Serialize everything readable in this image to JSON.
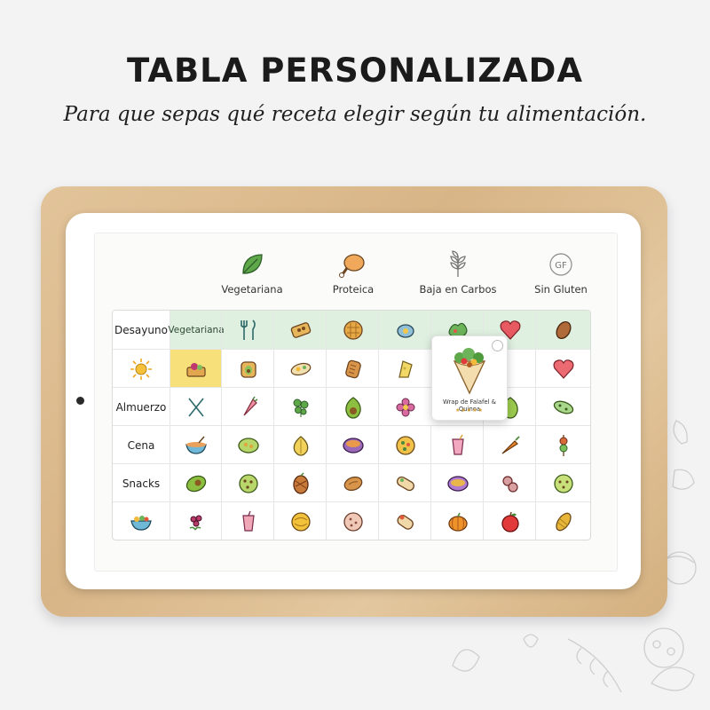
{
  "header": {
    "title": "TABLA PERSONALIZADA",
    "subtitle": "Para que sepas qué receta elegir según tu alimentación."
  },
  "legend": [
    {
      "label": "Vegetariana",
      "icon": "leaf-icon"
    },
    {
      "label": "Proteica",
      "icon": "chicken-leg-icon"
    },
    {
      "label": "Baja en Carbos",
      "icon": "wheat-icon"
    },
    {
      "label": "Sin Gluten",
      "icon": "gf-badge-icon"
    }
  ],
  "table": {
    "header_chip": "Vegetariana",
    "rows": [
      {
        "label": "Desayuno",
        "icons": [
          "vegetariana-chip",
          "cutlery-icon",
          "toast-icon",
          "waffle-icon",
          "egg-avocado-icon",
          "salad-icon",
          "heart-icon",
          "almond-icon"
        ]
      },
      {
        "label": "",
        "label_icon": "sun-icon",
        "icons": [
          "avocado-toast-icon",
          "avocado-toast-small-icon",
          "egg-toast-icon",
          "bread-icon",
          "cheese-icon",
          "salad-bowl-icon",
          "heart-icon"
        ]
      },
      {
        "label": "Almuerzo",
        "icons": [
          "cutlery-cross-icon",
          "carrot-wrap-icon",
          "herb-icon",
          "avocado-icon",
          "flower-plate-icon",
          "wrap-icon",
          "cucumber-icon"
        ]
      },
      {
        "label": "Cena",
        "icons": [
          "soup-bowl-icon",
          "curry-bowl-icon",
          "onion-icon",
          "soup-icon",
          "pizza-icon",
          "smoothie-icon",
          "carrot-icon",
          "skewer-icon"
        ]
      },
      {
        "label": "Snacks",
        "icons": [
          "avocado-half-icon",
          "cookie-icon",
          "pinecone-icon",
          "bread-loaf-icon",
          "burrito-icon",
          "stew-bowl-icon",
          "tomato-slices-icon",
          "cracker-icon"
        ]
      },
      {
        "label": "",
        "label_icon": "salad-bowl-icon",
        "icons": [
          "berries-icon",
          "drink-icon",
          "pasta-ball-icon",
          "cookie-icon",
          "wrap-roll-icon",
          "pumpkin-icon",
          "apple-icon",
          "corn-icon"
        ]
      }
    ]
  },
  "popup": {
    "title": "Wrap de Falafel & Quinoa",
    "stars": "★★★★★",
    "icon": "wrap-image-icon"
  },
  "colors": {
    "header_row": "#dff0e0",
    "highlight": "#f7df7a",
    "board": "#d8b587"
  }
}
